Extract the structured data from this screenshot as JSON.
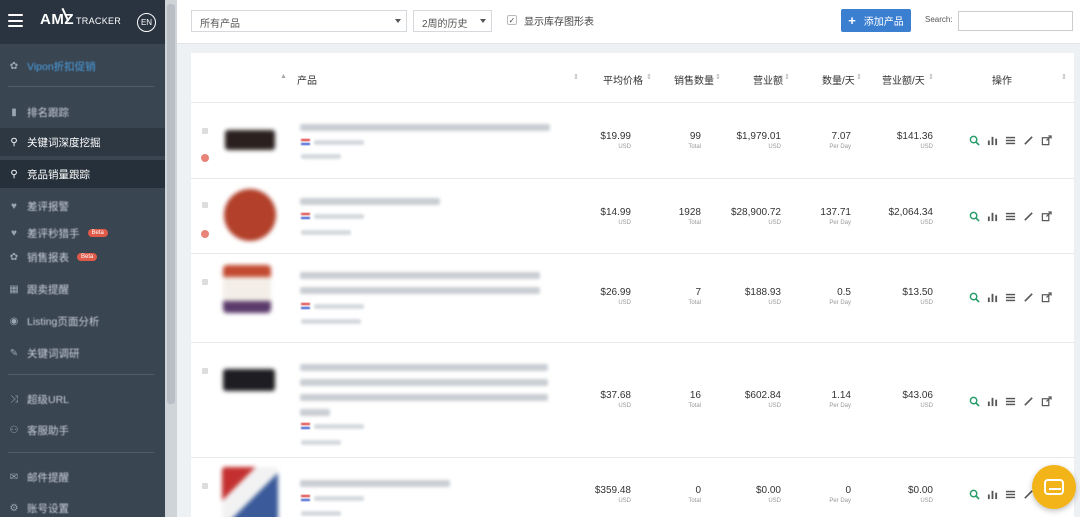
{
  "sidebar": {
    "logo_main": "AMZ",
    "logo_sub": "TRACKER",
    "lang": "EN",
    "items": [
      {
        "label": "Vipon折扣促销",
        "icon": "gift-icon"
      },
      {
        "label": "排名跟踪",
        "icon": "bar-chart-icon"
      },
      {
        "label": "关键词深度挖掘",
        "icon": "search-icon"
      },
      {
        "label": "竞品销量跟踪",
        "icon": "search-icon"
      },
      {
        "label": "差评报警",
        "icon": "heart-icon"
      },
      {
        "label": "差评秒猎手",
        "icon": "heart-icon",
        "badge": "Beta"
      },
      {
        "label": "销售报表",
        "icon": "gift-icon",
        "badge": "Beta"
      },
      {
        "label": "跟卖提醒",
        "icon": "grid-icon"
      },
      {
        "label": "Listing页面分析",
        "icon": "eye-icon"
      },
      {
        "label": "关键词调研",
        "icon": "tool-icon"
      },
      {
        "label": "超级URL",
        "icon": "shuffle-icon"
      },
      {
        "label": "客服助手",
        "icon": "sitemap-icon"
      },
      {
        "label": "邮件提醒",
        "icon": "mail-icon"
      },
      {
        "label": "账号设置",
        "icon": "gear-icon"
      }
    ]
  },
  "toolbar": {
    "product_filter": "所有产品",
    "history_filter": "2周的历史",
    "show_chart_label": "显示库存图形表",
    "add_label": "添加产品",
    "search_label": "Search:",
    "search_value": ""
  },
  "table": {
    "headers": {
      "product": "产品",
      "avg_price": "平均价格",
      "sales_qty": "销售数量",
      "revenue": "营业额",
      "qty_per_day": "数量/天",
      "revenue_per_day": "营业额/天",
      "actions": "操作"
    },
    "rows": [
      {
        "avg_price": "$19.99",
        "price_unit": "USD",
        "sales_qty": "99",
        "qty_unit": "Total",
        "revenue": "$1,979.01",
        "rev_unit": "USD",
        "qty_day": "7.07",
        "qty_day_unit": "Per Day",
        "rev_day": "$141.36",
        "rev_day_unit": "USD"
      },
      {
        "avg_price": "$14.99",
        "price_unit": "USD",
        "sales_qty": "1928",
        "qty_unit": "Total",
        "revenue": "$28,900.72",
        "rev_unit": "USD",
        "qty_day": "137.71",
        "qty_day_unit": "Per Day",
        "rev_day": "$2,064.34",
        "rev_day_unit": "USD"
      },
      {
        "avg_price": "$26.99",
        "price_unit": "USD",
        "sales_qty": "7",
        "qty_unit": "Total",
        "revenue": "$188.93",
        "rev_unit": "USD",
        "qty_day": "0.5",
        "qty_day_unit": "Per Day",
        "rev_day": "$13.50",
        "rev_day_unit": "USD"
      },
      {
        "avg_price": "$37.68",
        "price_unit": "USD",
        "sales_qty": "16",
        "qty_unit": "Total",
        "revenue": "$602.84",
        "rev_unit": "USD",
        "qty_day": "1.14",
        "qty_day_unit": "Per Day",
        "rev_day": "$43.06",
        "rev_day_unit": "USD"
      },
      {
        "avg_price": "$359.48",
        "price_unit": "USD",
        "sales_qty": "0",
        "qty_unit": "Total",
        "revenue": "$0.00",
        "rev_unit": "USD",
        "qty_day": "0",
        "qty_day_unit": "Per Day",
        "rev_day": "$0.00",
        "rev_day_unit": "USD"
      }
    ],
    "action_icons": [
      "search-icon",
      "bar-chart-icon",
      "list-icon",
      "edit-icon",
      "external-link-icon"
    ]
  },
  "colors": {
    "sidebar_bg": "#3a4552",
    "accent_blue": "#3b7fd1",
    "action_green": "#2a9d6a",
    "badge_red": "#e05a4a",
    "chat_yellow": "#f2b418"
  }
}
